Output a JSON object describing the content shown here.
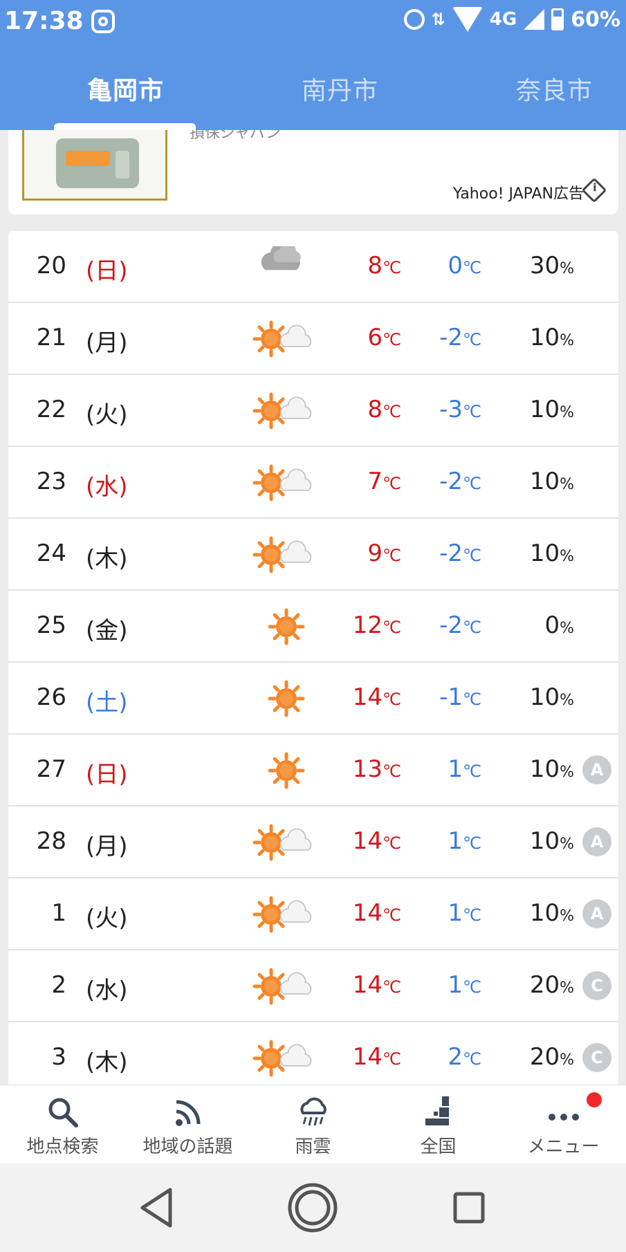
{
  "status_bar": {
    "time": "17:38",
    "network": "4G",
    "battery": "60%",
    "icons": [
      "instagram-icon",
      "alarm-icon",
      "data-arrows-icon",
      "wifi-icon",
      "signal-icon",
      "battery-icon"
    ]
  },
  "tabs": [
    {
      "label": "亀岡市",
      "active": true
    },
    {
      "label": "南丹市",
      "active": false
    },
    {
      "label": "奈良市",
      "active": false
    }
  ],
  "ad": {
    "cut_text": "損保ジャパン",
    "label": "Yahoo! JAPAN広告",
    "image": "toaster-product-image"
  },
  "units": {
    "temp": "℃",
    "pop": "%"
  },
  "forecast": [
    {
      "day": "20",
      "dow": "(日)",
      "dow_color": "red",
      "weather": "cloudy",
      "hi": "8",
      "lo": "0",
      "pop": "30",
      "reliability": ""
    },
    {
      "day": "21",
      "dow": "(月)",
      "dow_color": "normal",
      "weather": "sunny-cloudy",
      "hi": "6",
      "lo": "-2",
      "pop": "10",
      "reliability": ""
    },
    {
      "day": "22",
      "dow": "(火)",
      "dow_color": "normal",
      "weather": "sunny-cloudy",
      "hi": "8",
      "lo": "-3",
      "pop": "10",
      "reliability": ""
    },
    {
      "day": "23",
      "dow": "(水)",
      "dow_color": "red",
      "weather": "sunny-cloudy",
      "hi": "7",
      "lo": "-2",
      "pop": "10",
      "reliability": ""
    },
    {
      "day": "24",
      "dow": "(木)",
      "dow_color": "normal",
      "weather": "sunny-cloudy",
      "hi": "9",
      "lo": "-2",
      "pop": "10",
      "reliability": ""
    },
    {
      "day": "25",
      "dow": "(金)",
      "dow_color": "normal",
      "weather": "sunny",
      "hi": "12",
      "lo": "-2",
      "pop": "0",
      "reliability": ""
    },
    {
      "day": "26",
      "dow": "(土)",
      "dow_color": "blue",
      "weather": "sunny",
      "hi": "14",
      "lo": "-1",
      "pop": "10",
      "reliability": ""
    },
    {
      "day": "27",
      "dow": "(日)",
      "dow_color": "red",
      "weather": "sunny",
      "hi": "13",
      "lo": "1",
      "pop": "10",
      "reliability": "A"
    },
    {
      "day": "28",
      "dow": "(月)",
      "dow_color": "normal",
      "weather": "sunny-cloudy",
      "hi": "14",
      "lo": "1",
      "pop": "10",
      "reliability": "A"
    },
    {
      "day": "1",
      "dow": "(火)",
      "dow_color": "normal",
      "weather": "sunny-cloudy",
      "hi": "14",
      "lo": "1",
      "pop": "10",
      "reliability": "A"
    },
    {
      "day": "2",
      "dow": "(水)",
      "dow_color": "normal",
      "weather": "sunny-cloudy",
      "hi": "14",
      "lo": "1",
      "pop": "20",
      "reliability": "C"
    },
    {
      "day": "3",
      "dow": "(木)",
      "dow_color": "normal",
      "weather": "sunny-cloudy",
      "hi": "14",
      "lo": "2",
      "pop": "20",
      "reliability": "C"
    }
  ],
  "bottom_nav": [
    {
      "label": "地点検索",
      "icon": "search-icon"
    },
    {
      "label": "地域の話題",
      "icon": "rss-icon"
    },
    {
      "label": "雨雲",
      "icon": "rain-cloud-icon"
    },
    {
      "label": "全国",
      "icon": "japan-map-icon"
    },
    {
      "label": "メニュー",
      "icon": "more-icon",
      "badge": true
    }
  ],
  "colors": {
    "header": "#5b96e6",
    "hi_temp": "#d0181c",
    "lo_temp": "#3b7ad9",
    "sun": "#f5862a",
    "badge": "#f02828"
  }
}
